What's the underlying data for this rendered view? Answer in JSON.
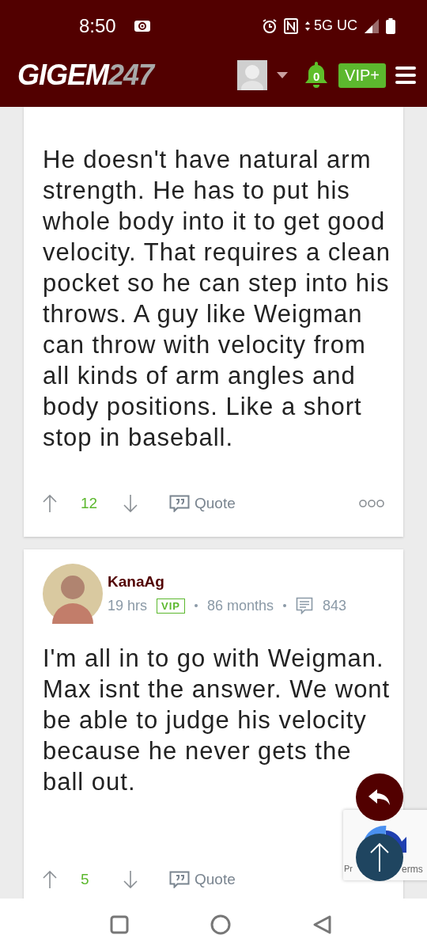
{
  "status_bar": {
    "time": "8:50",
    "network": "5G UC"
  },
  "header": {
    "logo_main": "GIGEM",
    "logo_accent": "247",
    "notification_count": "0",
    "vip_label": "VIP+"
  },
  "posts": [
    {
      "body": "He doesn't have natural arm strength. He has to put his whole body into it to get good velocity. That requires a clean pocket so he can step into his throws. A guy like Weigman can throw with velocity from all kinds of arm angles and body positions. Like a short stop in baseball.",
      "votes": "12",
      "quote_label": "Quote",
      "has_more_menu": true
    },
    {
      "author": {
        "name": "KanaAg",
        "time": "19 hrs",
        "badge": "VIP",
        "tenure": "86 months",
        "post_count": "843"
      },
      "body": "I'm all in to go with Weigman. Max isnt the answer. We wont be able to judge his velocity because he never gets the ball out.",
      "votes": "5",
      "quote_label": "Quote",
      "has_more_menu": false
    }
  ],
  "recaptcha": {
    "left_text": "Pr",
    "right_text": "erms"
  }
}
